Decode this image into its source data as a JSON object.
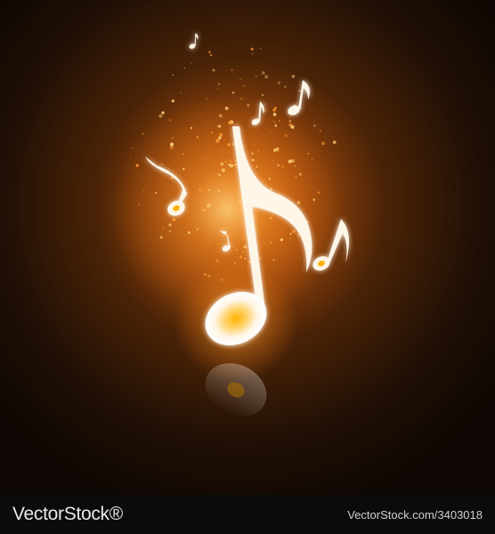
{
  "watermark": {
    "brand": "VectorStock®",
    "image_id": "VectorStock.com/3403018"
  },
  "colors": {
    "background_dark": "#1a0d04",
    "glow_core": "#ffb347",
    "glow_orange": "#d96a12",
    "note_fill": "#fff6e8",
    "note_center": "#ffb300",
    "footer_bg": "#0b0b0b"
  },
  "scene": {
    "main_note": "eighth-note",
    "small_notes": [
      "eighth-note",
      "eighth-note",
      "eighth-note",
      "eighth-note",
      "eighth-note",
      "eighth-note"
    ],
    "effects": [
      "orange-glow",
      "sparkle-particles",
      "floor-reflection"
    ]
  }
}
